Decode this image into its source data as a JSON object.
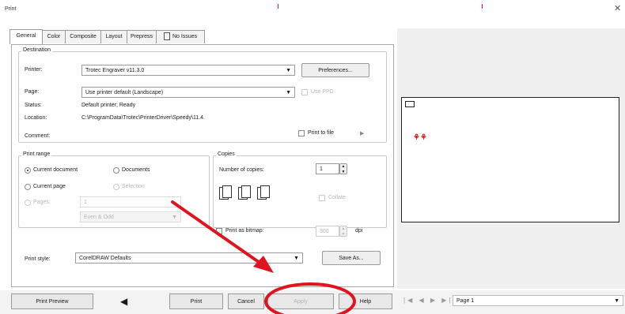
{
  "window": {
    "title": "Print",
    "close_glyph": "✕"
  },
  "tabs": [
    "General",
    "Color",
    "Composite",
    "Layout",
    "Prepress",
    "No Issues"
  ],
  "destination": {
    "group_label": "Destination",
    "printer_label": "Printer:",
    "printer_value": "Trotec Engraver v11.3.0",
    "preferences_button": "Preferences...",
    "page_label": "Page:",
    "page_value": "Use printer default (Landscape)",
    "use_ppd_label": "Use PPD",
    "status_label": "Status:",
    "status_value": "Default printer; Ready",
    "location_label": "Location:",
    "location_value": "C:\\ProgramData\\Trotec\\PrinterDriver\\Speedy\\11.4.",
    "comment_label": "Comment:",
    "print_to_file_label": "Print to file"
  },
  "print_range": {
    "group_label": "Print range",
    "current_document": "Current document",
    "documents": "Documents",
    "current_page": "Current page",
    "selection": "Selection",
    "pages": "Pages:",
    "pages_value": "1",
    "even_odd": "Even & Odd"
  },
  "copies": {
    "group_label": "Copies",
    "number_label": "Number of copies:",
    "number_value": "1",
    "collate_label": "Collate"
  },
  "bitmap": {
    "print_as_bitmap_label": "Print as bitmap:",
    "dpi_value": "300",
    "dpi_label": "dpi"
  },
  "print_style": {
    "label": "Print style:",
    "value": "CorelDRAW Defaults",
    "save_as_button": "Save As..."
  },
  "bottom": {
    "print_preview": "Print Preview",
    "print": "Print",
    "cancel": "Cancel",
    "apply": "Apply",
    "help": "Help",
    "page_nav_value": "Page 1"
  },
  "annotation": {
    "color": "#e0141e"
  }
}
